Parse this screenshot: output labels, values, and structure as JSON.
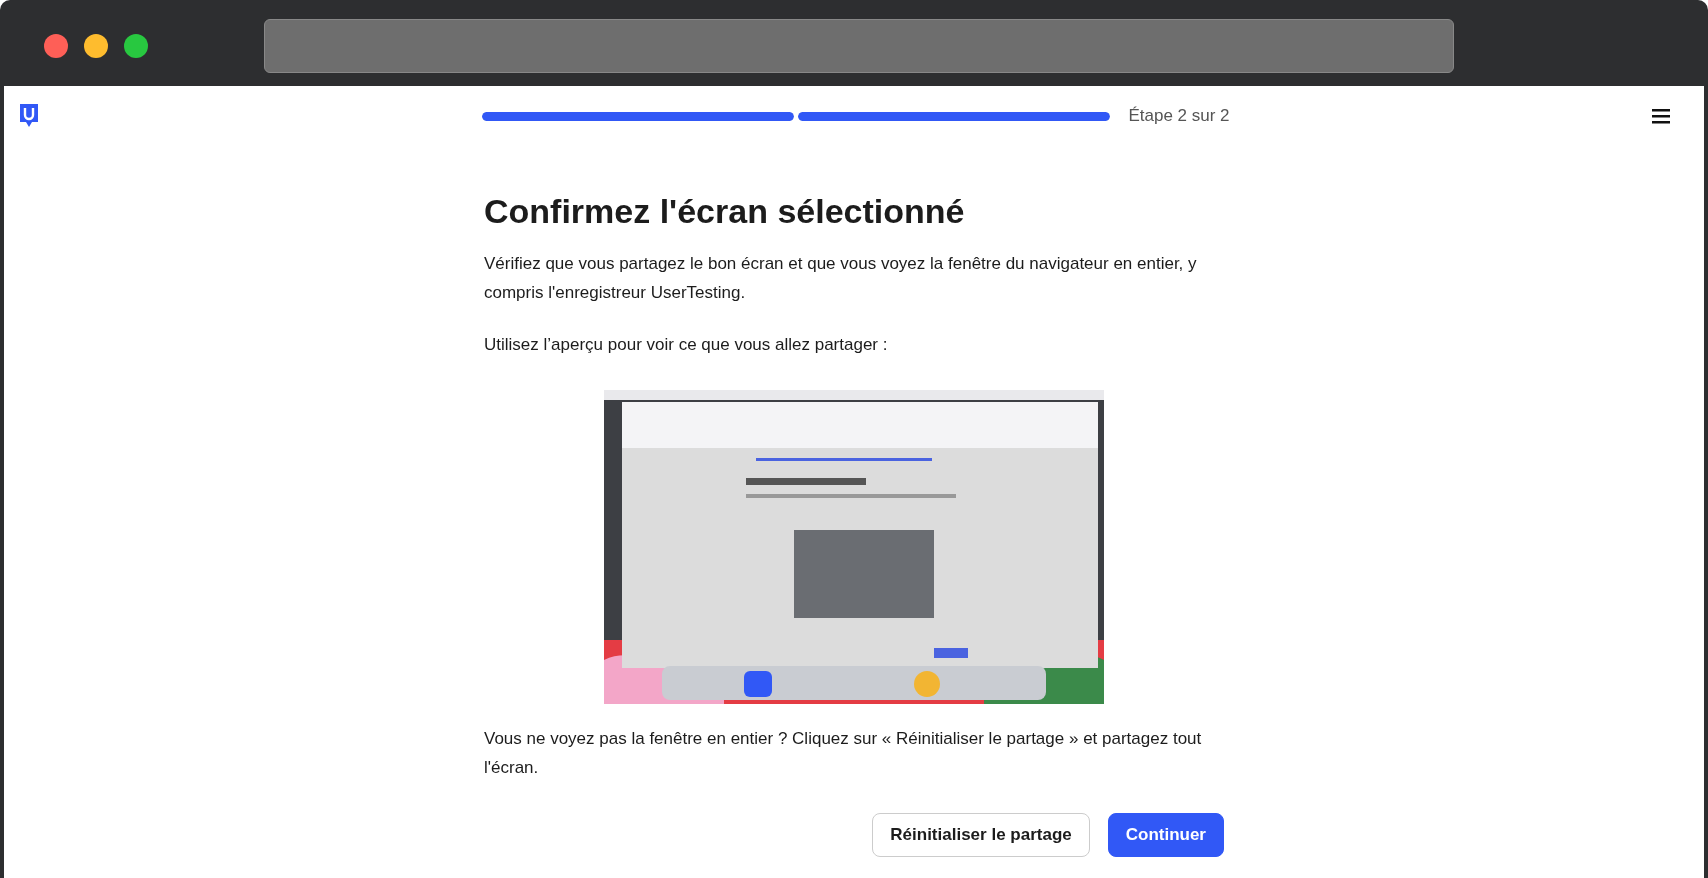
{
  "progress": {
    "segments": [
      {
        "level": 1
      },
      {
        "level": 1
      }
    ],
    "label": "Étape 2 sur 2"
  },
  "title": "Confirmez l'écran sélectionné",
  "intro": "Vérifiez que vous partagez le bon écran et que vous voyez la fenêtre du navigateur en entier, y compris l'enregistreur UserTesting.",
  "preview_prompt": "Utilisez l’aperçu pour voir ce que vous allez partager :",
  "hint": "Vous ne voyez pas la fenêtre en entier ? Cliquez sur « Réinitialiser le partage » et partagez tout l'écran.",
  "buttons": [
    {
      "label": "Réinitialiser le partage",
      "kind": "secondary"
    },
    {
      "label": "Continuer",
      "kind": "primary"
    }
  ]
}
